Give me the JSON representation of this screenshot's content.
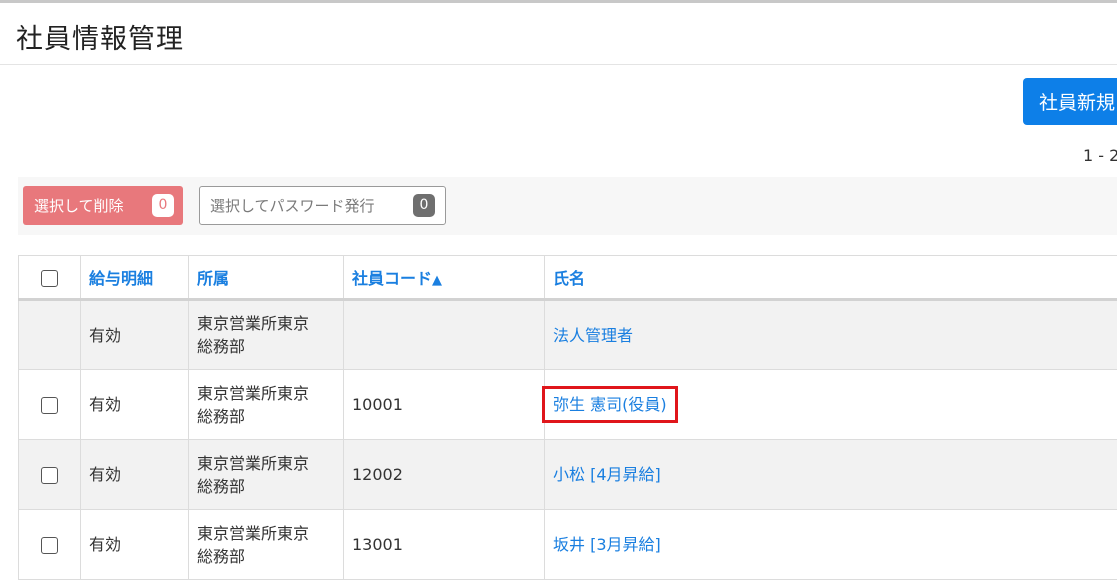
{
  "page": {
    "title": "社員情報管理"
  },
  "toolbar": {
    "new_employee_label": "社員新規",
    "pager_text": "1 - 2"
  },
  "actions": {
    "delete_label": "選択して削除",
    "delete_count": "0",
    "password_label": "選択してパスワード発行",
    "password_count": "0"
  },
  "table": {
    "headers": {
      "payslip": "給与明細",
      "department": "所属",
      "code": "社員コード",
      "code_sort": "▲",
      "name": "氏名"
    },
    "rows": [
      {
        "payslip": "有効",
        "dept_line1": "東京営業所東京",
        "dept_line2": "総務部",
        "code": "",
        "name": "法人管理者"
      },
      {
        "payslip": "有効",
        "dept_line1": "東京営業所東京",
        "dept_line2": "総務部",
        "code": "10001",
        "name": "弥生 憲司(役員)"
      },
      {
        "payslip": "有効",
        "dept_line1": "東京営業所東京",
        "dept_line2": "総務部",
        "code": "12002",
        "name": "小松 [4月昇給]"
      },
      {
        "payslip": "有効",
        "dept_line1": "東京営業所東京",
        "dept_line2": "総務部",
        "code": "13001",
        "name": "坂井 [3月昇給]"
      }
    ]
  },
  "colors": {
    "primary": "#0d7fe8",
    "danger": "#e8787c",
    "link": "#1a7fe0",
    "highlight_border": "#e0161b"
  }
}
